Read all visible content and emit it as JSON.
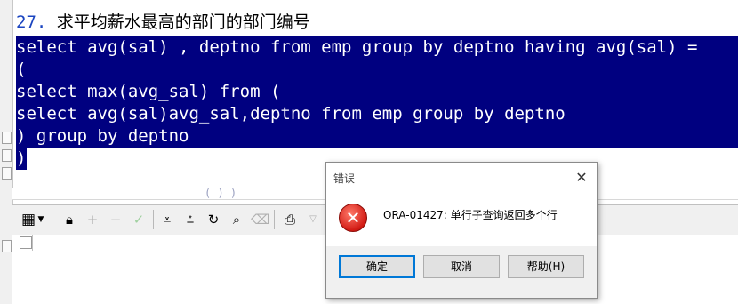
{
  "editor": {
    "title_number": "27.",
    "title_text": " 求平均薪水最高的部门的部门编号",
    "lines": [
      "select avg(sal) , deptno from emp group by deptno having avg(sal) =",
      "(",
      "select max(avg_sal) from (",
      "select avg(sal)avg_sal,deptno from emp group by deptno",
      ") group by deptno",
      ")"
    ],
    "ghost_text": "( ) )"
  },
  "toolbar": {
    "icons": [
      "grid-layout-icon",
      "dropdown-arrow-icon",
      "lock-icon",
      "add-record-icon",
      "delete-record-icon",
      "post-record-icon",
      "fetch-next-icon",
      "fetch-last-icon",
      "refresh-icon",
      "find-icon",
      "clear-icon",
      "export-icon",
      "filter-dropdown-icon"
    ]
  },
  "dialog": {
    "title": "错误",
    "message": "ORA-01427: 单行子查询返回多个行",
    "ok_label": "确定",
    "cancel_label": "取消",
    "help_label": "帮助(H)",
    "close_glyph": "✕",
    "icon_glyph": "✕"
  },
  "colors": {
    "selection": "#000080",
    "title_number": "#1a44c0",
    "error_red": "#d21b14"
  }
}
